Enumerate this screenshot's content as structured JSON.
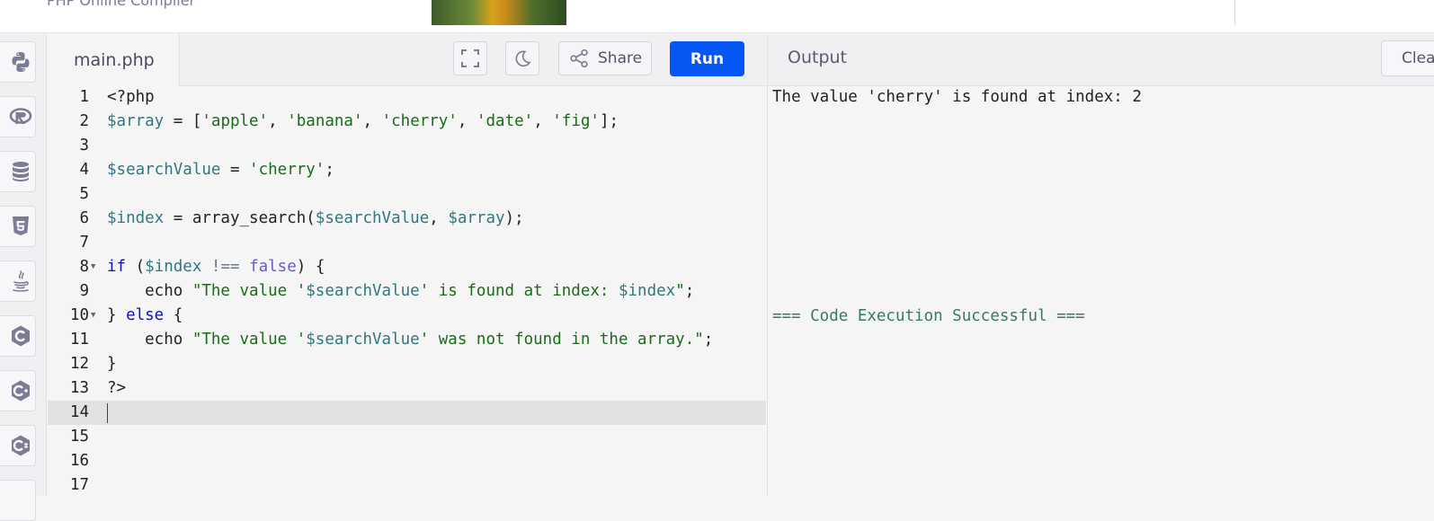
{
  "topbar": {
    "brand": "PHP Online Compiler"
  },
  "languages": [
    {
      "name": "python-icon"
    },
    {
      "name": "r-icon"
    },
    {
      "name": "sql-icon"
    },
    {
      "name": "html5-icon"
    },
    {
      "name": "java-icon"
    },
    {
      "name": "c-icon"
    },
    {
      "name": "cpp-icon"
    },
    {
      "name": "csharp-icon"
    }
  ],
  "editor": {
    "filename": "main.php",
    "share_label": "Share",
    "run_label": "Run",
    "active_line": 14,
    "line_numbers": [
      "1",
      "2",
      "3",
      "4",
      "5",
      "6",
      "7",
      "8",
      "9",
      "10",
      "11",
      "12",
      "13",
      "14",
      "15",
      "16",
      "17"
    ],
    "code": {
      "l1": "<?php",
      "l2_var": "$array",
      "l2_eq": " = [",
      "l2_s1": "'apple'",
      "l2_c1": ", ",
      "l2_s2": "'banana'",
      "l2_c2": ", ",
      "l2_s3": "'cherry'",
      "l2_c3": ", ",
      "l2_s4": "'date'",
      "l2_c4": ", ",
      "l2_s5": "'fig'",
      "l2_end": "];",
      "l4_var": "$searchValue",
      "l4_eq": " = ",
      "l4_str": "'cherry'",
      "l4_end": ";",
      "l6_var": "$index",
      "l6_eq": " = array_search(",
      "l6_arg1": "$searchValue",
      "l6_comma": ", ",
      "l6_arg2": "$array",
      "l6_end": ");",
      "l8_kw": "if",
      "l8_open": " (",
      "l8_var": "$index",
      "l8_op": " !== ",
      "l8_bool": "false",
      "l8_end": ") {",
      "l9_echo": "    echo ",
      "l9_s1": "\"The value '",
      "l9_v1": "$searchValue",
      "l9_s2": "' is found at index: ",
      "l9_v2": "$index",
      "l9_s3": "\"",
      "l9_end": ";",
      "l10_a": "} ",
      "l10_kw": "else",
      "l10_b": " {",
      "l11_echo": "    echo ",
      "l11_s1": "\"The value '",
      "l11_v1": "$searchValue",
      "l11_s2": "' was not found in the array.\"",
      "l11_end": ";",
      "l12": "}",
      "l13": "?>"
    }
  },
  "output": {
    "title": "Output",
    "clear_label": "Clear",
    "lines": [
      "The value 'cherry' is found at index: 2",
      "=== Code Execution Successful ==="
    ]
  },
  "colors": {
    "run_button": "#0556f3",
    "success_text": "#3a7a5a"
  }
}
